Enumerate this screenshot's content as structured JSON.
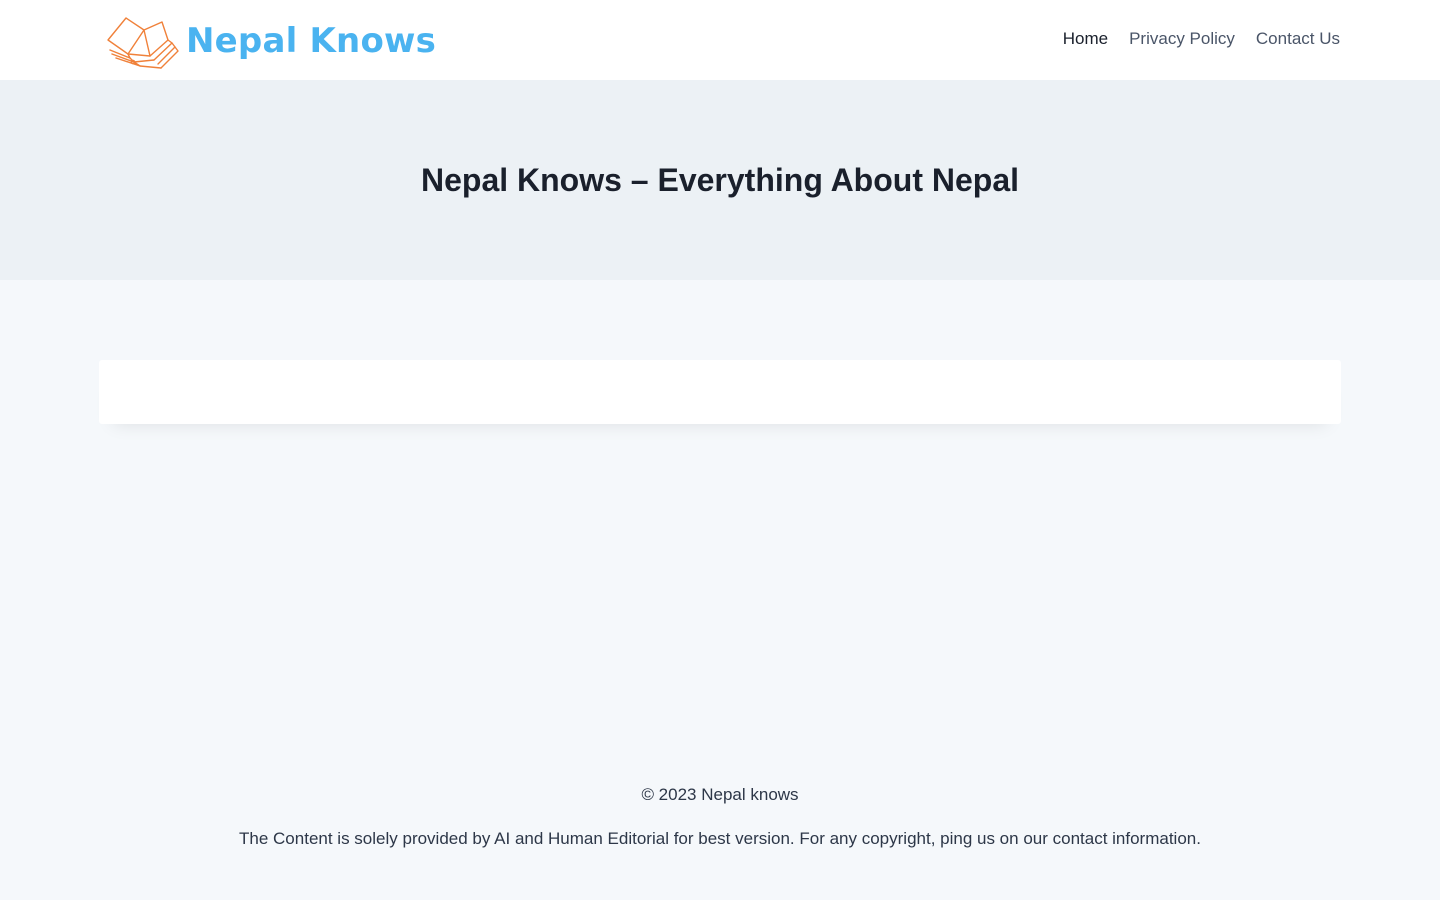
{
  "header": {
    "logo_text": "Nepal Knows",
    "logo_icon": "open-book-icon",
    "logo_icon_color": "#f0813a",
    "logo_text_color": "#4ab3f0",
    "nav": [
      {
        "label": "Home",
        "current": true
      },
      {
        "label": "Privacy Policy",
        "current": false
      },
      {
        "label": "Contact Us",
        "current": false
      }
    ]
  },
  "hero": {
    "title": "Nepal Knows – Everything About Nepal"
  },
  "footer": {
    "copyright": "© 2023 Nepal knows",
    "note": "The Content is solely provided by AI and Human Editorial for best version. For any copyright, ping us on our contact information."
  }
}
